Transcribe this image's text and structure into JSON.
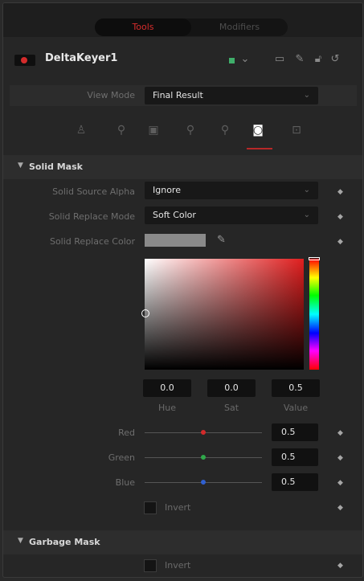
{
  "tabs": [
    {
      "label": "Tools",
      "active": true
    },
    {
      "label": "Modifiers",
      "active": false
    }
  ],
  "node": {
    "title": "DeltaKeyer1",
    "color": "#d42b2b"
  },
  "header_icons": [
    "green-square-icon",
    "chevron-down-icon",
    "window-icon",
    "pin-icon",
    "lock-icon",
    "reset-icon"
  ],
  "view_mode": {
    "label": "View Mode",
    "value": "Final Result"
  },
  "tool_tabs": [
    "keyer-icon",
    "pre-matte-icon",
    "matte-icon",
    "fringe-icon",
    "tuning-icon",
    "mask-icon",
    "transform-icon"
  ],
  "active_tool_tab": "mask-icon",
  "accent_color": "#b72828",
  "solid_mask": {
    "title": "Solid Mask",
    "source_alpha": {
      "label": "Solid Source Alpha",
      "value": "Ignore"
    },
    "replace_mode": {
      "label": "Solid Replace Mode",
      "value": "Soft Color"
    },
    "replace_color": {
      "label": "Solid Replace Color",
      "swatch": "#8a8a8a"
    },
    "hsv": {
      "hue": {
        "value": "0.0",
        "label": "Hue"
      },
      "sat": {
        "value": "0.0",
        "label": "Sat"
      },
      "val": {
        "value": "0.5",
        "label": "Value"
      }
    },
    "channels": [
      {
        "label": "Red",
        "value": "0.5",
        "color": "#d22a2a"
      },
      {
        "label": "Green",
        "value": "0.5",
        "color": "#2fa84a"
      },
      {
        "label": "Blue",
        "value": "0.5",
        "color": "#2f5fd0"
      }
    ],
    "invert_label": "Invert"
  },
  "garbage_mask": {
    "title": "Garbage Mask",
    "invert_label": "Invert"
  }
}
